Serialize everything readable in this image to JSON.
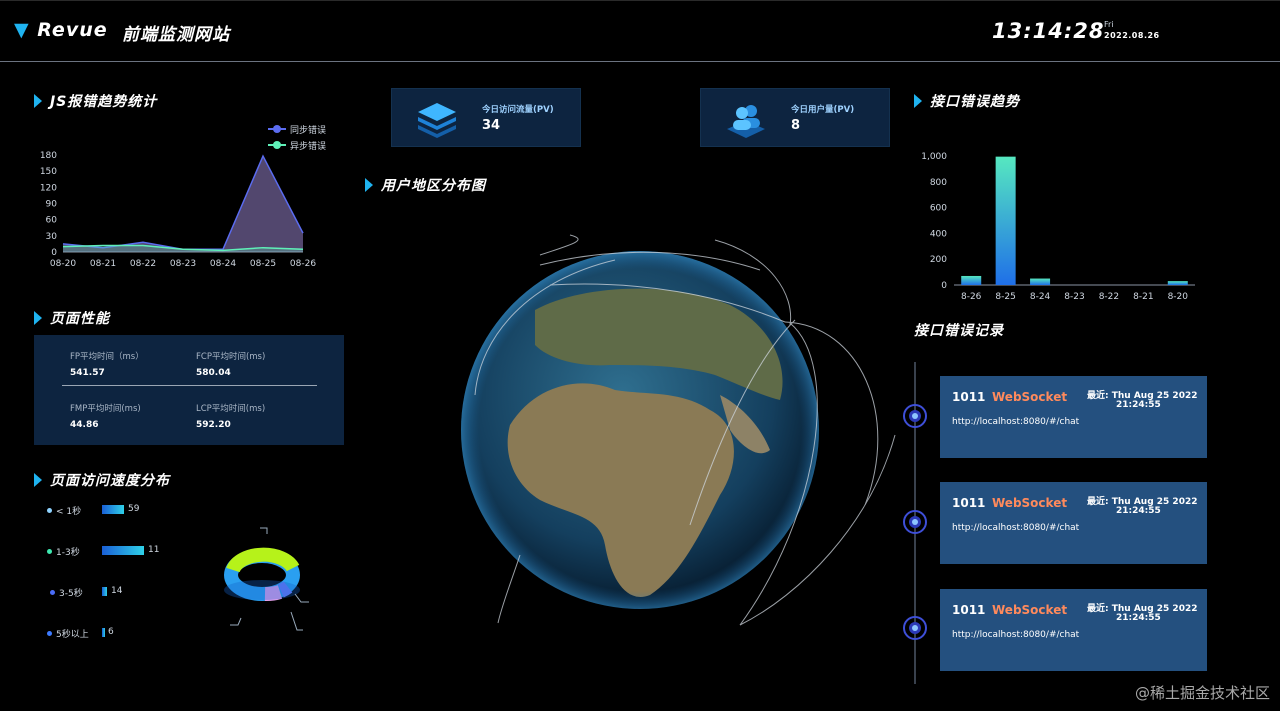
{
  "header": {
    "logo_text": "Revue",
    "title": "前端监测网站",
    "clock": "13:14:28",
    "weekday": "Fri",
    "date": "2022.08.26"
  },
  "js_errors": {
    "title": "JS报错趋势统计",
    "legend": [
      "同步错误",
      "异步错误"
    ]
  },
  "stats": {
    "pv": {
      "label": "今日访问流量(PV)",
      "value": "34"
    },
    "uv": {
      "label": "今日用户量(PV)",
      "value": "8"
    }
  },
  "map_title": "用户地区分布图",
  "api_trend_title": "接口错误趋势",
  "performance": {
    "title": "页面性能",
    "items": [
      {
        "label": "FP平均时间（ms）",
        "value": "541.57"
      },
      {
        "label": "FCP平均时间(ms)",
        "value": "580.04"
      },
      {
        "label": "FMP平均时间(ms)",
        "value": "44.86"
      },
      {
        "label": "LCP平均时间(ms)",
        "value": "592.20"
      }
    ]
  },
  "speed": {
    "title": "页面访问速度分布",
    "rows": [
      {
        "label": "< 1秒",
        "value": 59,
        "color": "#8fd3ff"
      },
      {
        "label": "1-3秒",
        "value": 11,
        "color": "#3ee8b0"
      },
      {
        "label": "3-5秒",
        "value": 14,
        "color": "#4a6cf7"
      },
      {
        "label": "5秒以上",
        "value": 6,
        "color": "#3d7bff"
      }
    ]
  },
  "api_records": {
    "title": "接口错误记录",
    "items": [
      {
        "code": "1011",
        "type": "WebSocket",
        "recent": "最近: Thu Aug 25 2022",
        "time": "21:24:55",
        "url": "http://localhost:8080/#/chat"
      },
      {
        "code": "1011",
        "type": "WebSocket",
        "recent": "最近: Thu Aug 25 2022",
        "time": "21:24:55",
        "url": "http://localhost:8080/#/chat"
      },
      {
        "code": "1011",
        "type": "WebSocket",
        "recent": "最近: Thu Aug 25 2022",
        "time": "21:24:55",
        "url": "http://localhost:8080/#/chat"
      }
    ]
  },
  "watermark": "@稀土掘金技术社区",
  "chart_data": [
    {
      "type": "area",
      "title": "JS报错趋势统计",
      "categories": [
        "08-20",
        "08-21",
        "08-22",
        "08-23",
        "08-24",
        "08-25",
        "08-26"
      ],
      "ylim": [
        0,
        180
      ],
      "yticks": [
        0,
        30,
        60,
        90,
        120,
        150,
        180
      ],
      "legend_position": "top-right",
      "series": [
        {
          "name": "同步错误",
          "color": "#5b6cf0",
          "values": [
            15,
            8,
            18,
            5,
            5,
            178,
            35
          ]
        },
        {
          "name": "异步错误",
          "color": "#5ff0b8",
          "values": [
            10,
            12,
            12,
            5,
            3,
            8,
            5
          ]
        }
      ]
    },
    {
      "type": "bar",
      "title": "接口错误趋势",
      "categories": [
        "8-26",
        "8-25",
        "8-24",
        "8-23",
        "8-22",
        "8-21",
        "8-20"
      ],
      "values": [
        70,
        995,
        50,
        0,
        0,
        0,
        30
      ],
      "ylim": [
        0,
        1000
      ],
      "yticks": [
        0,
        200,
        400,
        600,
        800,
        "1,000"
      ],
      "gradient": [
        "#56e8c0",
        "#1f6fe8"
      ]
    }
  ]
}
